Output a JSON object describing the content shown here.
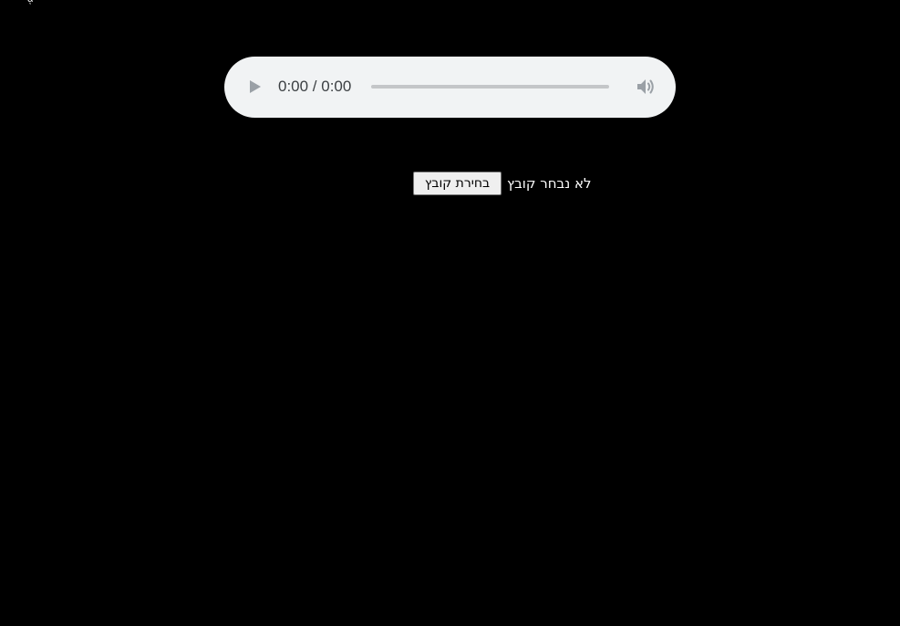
{
  "page": {
    "corner_mark": "ᾳ"
  },
  "audio": {
    "current_time": "0:00",
    "duration": "0:00",
    "time_text": "0:00 / 0:00",
    "progress": 0,
    "play_icon": "play-icon",
    "volume_icon": "volume-icon",
    "colors": {
      "background": "#f1f3f4",
      "icon": "#9aa0a6",
      "text": "#3c4043"
    }
  },
  "file_input": {
    "button_label": "בחירת קובץ",
    "status_text": "לא נבחר קובץ"
  }
}
